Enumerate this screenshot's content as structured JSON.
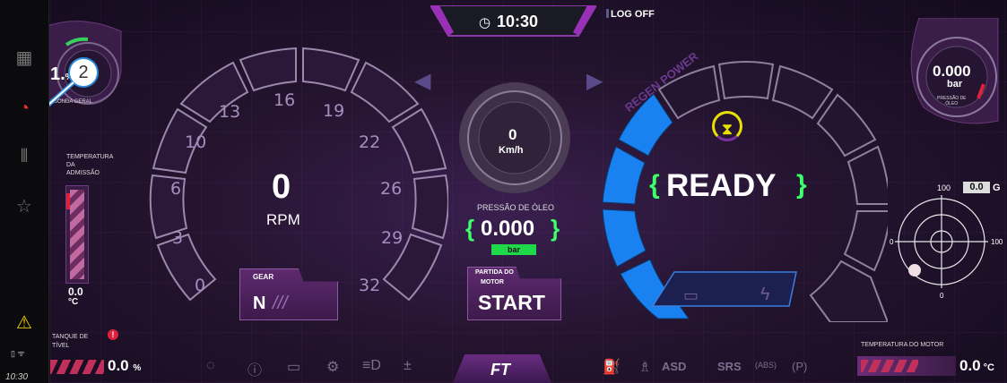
{
  "header": {
    "time": "10:30",
    "logoff_label": "LOG OFF",
    "clock_icon": "clock-icon"
  },
  "sidebar": {
    "items": [
      {
        "name": "grid-icon",
        "glyph": "▦"
      },
      {
        "name": "gauge-icon",
        "glyph": "◔"
      },
      {
        "name": "bars-icon",
        "glyph": "⦀"
      },
      {
        "name": "star-icon",
        "glyph": "☆"
      }
    ],
    "warning_glyph": "⚠",
    "status_time": "10:30",
    "annotation_number": "2"
  },
  "left_gauge_small": {
    "value": "1.",
    "value_suffix": "%",
    "label": "SONDA GERAL"
  },
  "intake_temp": {
    "label_lines": [
      "TEMPERATURA",
      "DA",
      "ADMISSÃO"
    ],
    "value": "0.0",
    "unit": "°C"
  },
  "rpm": {
    "value": "0",
    "label": "RPM",
    "ticks": [
      "0",
      "3",
      "6",
      "10",
      "13",
      "16",
      "19",
      "22",
      "26",
      "29",
      "32"
    ]
  },
  "gear": {
    "label": "GEAR",
    "value": "N",
    "slashes": "///"
  },
  "speed": {
    "value": "0",
    "unit": "Km/h"
  },
  "oil_pressure_center": {
    "label": "PRESSÃO DE ÓLEO",
    "value": "0.000",
    "unit": "bar"
  },
  "start_button": {
    "label_top": "PARTIDA DO",
    "label_bottom": "MOTOR",
    "value": "START"
  },
  "power": {
    "arc_label": "REGEN POWER",
    "status": "READY",
    "hourglass": "⧗"
  },
  "right_small_gauge": {
    "value": "0.000",
    "unit": "bar",
    "label_lines": [
      "PRESSÃO DE",
      "ÓLEO"
    ]
  },
  "g_meter": {
    "top_label": "100",
    "g_value": "0.0",
    "g_unit": "G",
    "left": "0",
    "right": "100",
    "bottom": "0"
  },
  "fuel": {
    "label_line1": "TANQUE DE",
    "label_line2": "TÍVEL",
    "value": "0.0",
    "unit": "%"
  },
  "engine_temp": {
    "label": "TEMPERATURA DO MOTOR",
    "value": "0.0",
    "unit": "°C"
  },
  "bottom_indicators": {
    "left": [
      "◌",
      "ⓘ",
      "▭",
      "⚙",
      "≡D",
      "±"
    ],
    "right": [
      "⛽",
      "♗",
      "ASD",
      "SRS",
      "(ABS)",
      "(P)"
    ],
    "logo": "FT"
  }
}
